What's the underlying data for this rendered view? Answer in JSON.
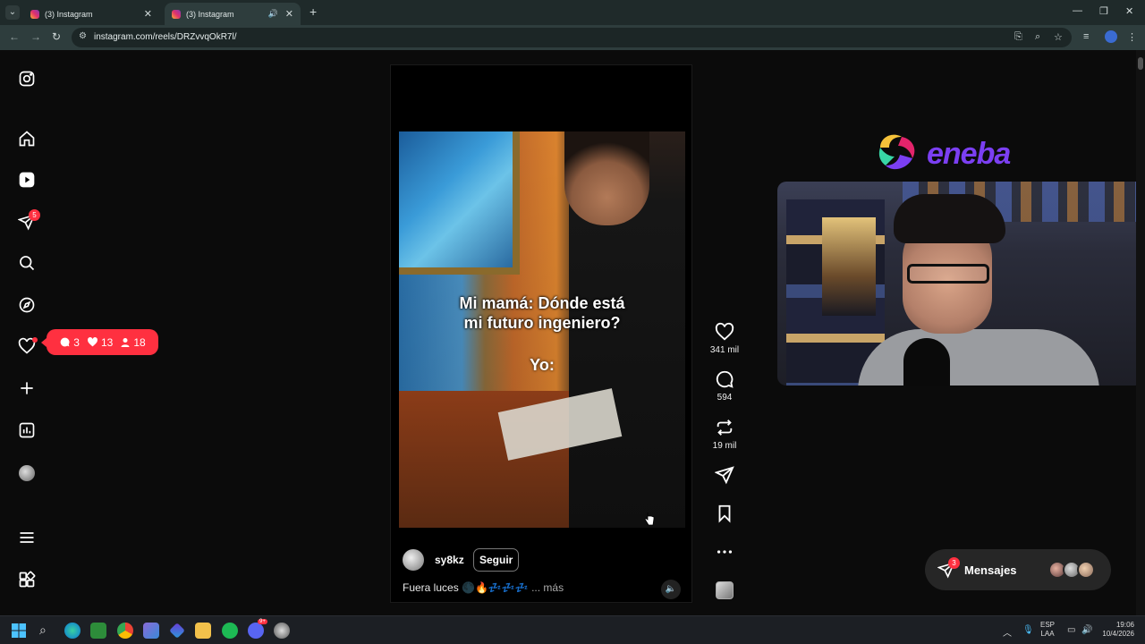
{
  "browser": {
    "tabs": [
      {
        "title": "(3) Instagram",
        "active": false
      },
      {
        "title": "(3) Instagram",
        "active": true,
        "audio": true
      }
    ],
    "url": "instagram.com/reels/DRZvvqOkR7l/"
  },
  "sidebar": {
    "items": [
      {
        "icon": "instagram-logo-icon"
      },
      {
        "icon": "home-icon"
      },
      {
        "icon": "reels-icon"
      },
      {
        "icon": "direct-messages-icon",
        "badge": "5"
      },
      {
        "icon": "search-icon"
      },
      {
        "icon": "explore-icon"
      },
      {
        "icon": "notifications-heart-icon",
        "dot": true
      },
      {
        "icon": "create-plus-icon"
      },
      {
        "icon": "dashboard-icon"
      },
      {
        "icon": "profile-avatar"
      },
      {
        "icon": "menu-icon"
      },
      {
        "icon": "more-apps-icon"
      }
    ],
    "notification_pill": {
      "comments": "3",
      "likes": "13",
      "follows": "18"
    }
  },
  "reel": {
    "caption_line": "Mi mamá: Dónde está\nmi futuro ingeniero?",
    "caption_yo": "Yo:",
    "username": "sy8kz",
    "follow_label": "Seguir",
    "description": "Fuera luces 🌑🔥💤💤💤",
    "more_label": "... más"
  },
  "actions": {
    "likes": "341 mil",
    "comments": "594",
    "reposts": "19 mil"
  },
  "overlay": {
    "sponsor_word": "eneba"
  },
  "messages": {
    "label": "Mensajes",
    "badge": "3"
  },
  "taskbar": {
    "lang_line1": "ESP",
    "lang_line2": "LAA",
    "time": "19:06",
    "date": "10/4/2026",
    "discord_badge": "9+"
  },
  "colors": {
    "accent_red": "#ff3040",
    "eneba_purple": "#7b3ff2",
    "chrome_bg": "#1f2a2a"
  }
}
